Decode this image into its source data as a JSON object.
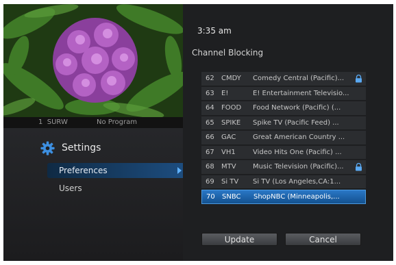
{
  "preview": {
    "channel_number": "1",
    "channel_call": "SURW",
    "program": "No Program"
  },
  "menu": {
    "title": "Settings",
    "items": [
      {
        "label": "Preferences",
        "active": true
      },
      {
        "label": "Users",
        "active": false
      }
    ]
  },
  "header": {
    "time": "3:35 am",
    "section": "Channel Blocking"
  },
  "channels": [
    {
      "num": "62",
      "call": "CMDY",
      "name": "Comedy Central (Pacific)...",
      "locked": true,
      "selected": false
    },
    {
      "num": "63",
      "call": "E!",
      "name": "E! Entertainment Televisio...",
      "locked": false,
      "selected": false
    },
    {
      "num": "64",
      "call": "FOOD",
      "name": "Food Network (Pacific) (...",
      "locked": false,
      "selected": false
    },
    {
      "num": "65",
      "call": "SPIKE",
      "name": "Spike TV (Pacific Feed) ...",
      "locked": false,
      "selected": false
    },
    {
      "num": "66",
      "call": "GAC",
      "name": "Great American Country ...",
      "locked": false,
      "selected": false
    },
    {
      "num": "67",
      "call": "VH1",
      "name": "Video Hits One (Pacific) ...",
      "locked": false,
      "selected": false
    },
    {
      "num": "68",
      "call": "MTV",
      "name": "Music Television (Pacific)...",
      "locked": true,
      "selected": false
    },
    {
      "num": "69",
      "call": "Si TV",
      "name": "Si TV (Los Angeles,CA:1...",
      "locked": false,
      "selected": false
    },
    {
      "num": "70",
      "call": "SNBC",
      "name": "ShopNBC (Minneapolis,...",
      "locked": false,
      "selected": true
    }
  ],
  "buttons": {
    "update": "Update",
    "cancel": "Cancel"
  },
  "colors": {
    "accent": "#1f64ad",
    "background": "#1e1f21",
    "row": "#2b2d30"
  },
  "icons": [
    "gear-icon",
    "lock-icon",
    "chevron-right-icon"
  ]
}
